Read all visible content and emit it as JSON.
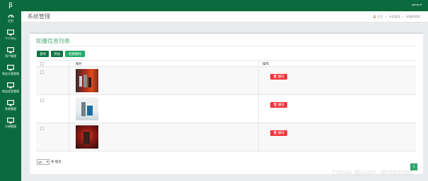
{
  "app": {
    "logo_text": "β",
    "user_label": "admin ▾"
  },
  "sidebar": {
    "items": [
      {
        "label": "主页",
        "icon": "dashboard-icon"
      },
      {
        "label": "个人中心",
        "icon": "monitor-icon"
      },
      {
        "label": "用户管理",
        "icon": "monitor-icon"
      },
      {
        "label": "商品分类管理",
        "icon": "monitor-icon"
      },
      {
        "label": "商品信息管理",
        "icon": "monitor-icon"
      },
      {
        "label": "系统管理",
        "icon": "monitor-icon"
      },
      {
        "label": "订单管理",
        "icon": "monitor-icon"
      }
    ]
  },
  "header": {
    "title": "系统管理",
    "breadcrumb": [
      "🏠 主页",
      ">",
      "系统管理",
      ">",
      "轮播图管理"
    ]
  },
  "panel": {
    "title": "轮播信息列表",
    "buttons": {
      "search": "查询",
      "add": "添加",
      "batch_delete": "批量删除"
    },
    "columns": {
      "image": "图片",
      "action": "操作"
    },
    "rows": [
      {
        "image": "product-image-1",
        "delete_label": "删除"
      },
      {
        "image": "product-image-2",
        "delete_label": "删除"
      },
      {
        "image": "product-image-3",
        "delete_label": "删除"
      }
    ],
    "pagination": {
      "page_size": "10",
      "suffix": "条 每页",
      "current_page": "1"
    }
  },
  "watermark": "CSDN @2401_85762266",
  "colors": {
    "primary": "#0c6b3e",
    "accent": "#23ab69",
    "danger": "#f0353c",
    "title_green": "#4fae7e"
  }
}
